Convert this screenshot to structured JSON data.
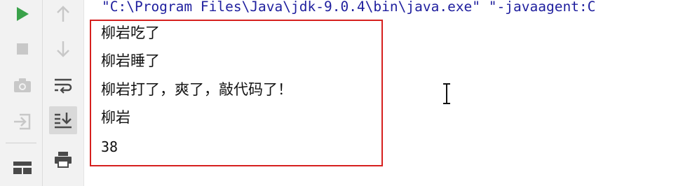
{
  "console": {
    "command_line": "\"C:\\Program Files\\Java\\jdk-9.0.4\\bin\\java.exe\" \"-javaagent:C",
    "output": [
      "柳岩吃了",
      "柳岩睡了",
      "柳岩打了，爽了，敲代码了！",
      "柳岩",
      "38"
    ]
  },
  "toolbar": {
    "left": [
      {
        "icon": "run-icon",
        "color": "#3aa24a"
      },
      {
        "icon": "stop-icon",
        "color": "#c8c8c8"
      },
      {
        "icon": "camera-icon",
        "color": "#c8c8c8"
      },
      {
        "icon": "exit-icon",
        "color": "#c8c8c8"
      },
      {
        "icon": "layout-icon",
        "color": "#4a4a4a"
      }
    ],
    "right": [
      {
        "icon": "arrow-up-icon",
        "color": "#c8c8c8"
      },
      {
        "icon": "arrow-down-icon",
        "color": "#c8c8c8"
      },
      {
        "icon": "soft-wrap-icon",
        "color": "#4a4a4a"
      },
      {
        "icon": "scroll-to-end-icon",
        "color": "#4a4a4a"
      },
      {
        "icon": "print-icon",
        "color": "#4a4a4a"
      }
    ]
  },
  "highlight_color": "#d6201e"
}
